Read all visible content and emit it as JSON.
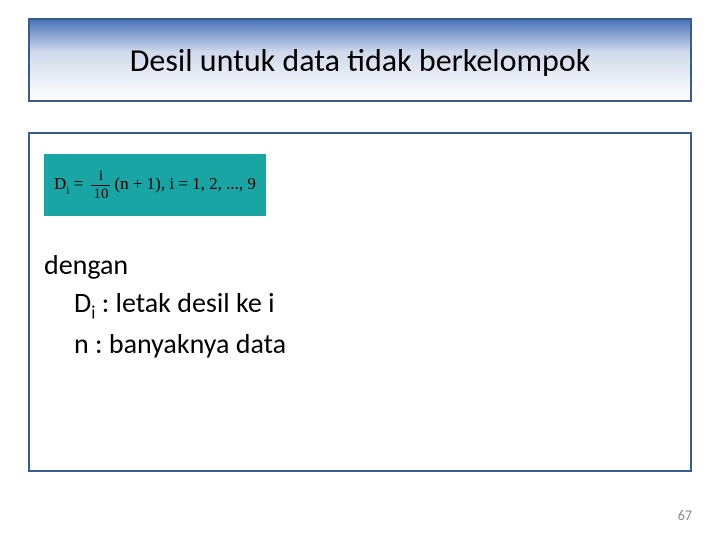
{
  "title": "Desil untuk data tidak berkelompok",
  "formula": {
    "lhs_base": "D",
    "lhs_sub": "i",
    "equals": " = ",
    "frac_num": "i",
    "frac_den": "10",
    "rhs": "(n + 1),",
    "range": "   i = 1, 2, ..., 9"
  },
  "description": {
    "line1": "dengan",
    "line2_pre": "D",
    "line2_sub": "i",
    "line2_post": " : letak desil ke i",
    "line3": "n  : banyaknya data"
  },
  "page_number": "67"
}
